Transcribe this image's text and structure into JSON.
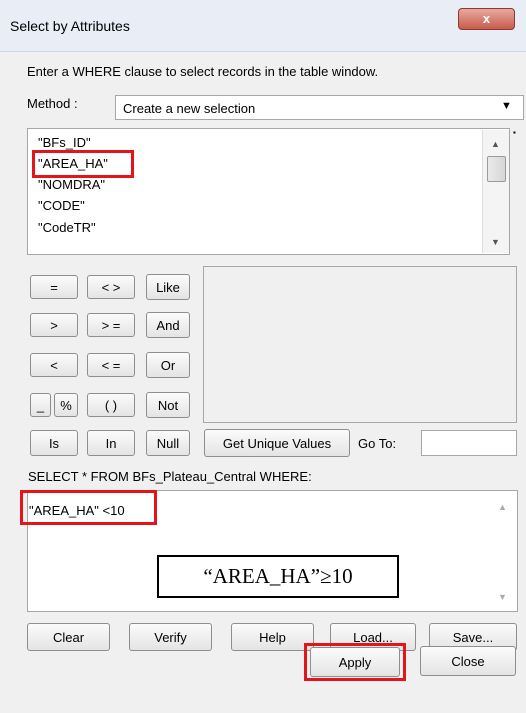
{
  "window": {
    "title": "Select by Attributes",
    "close_label": "x"
  },
  "instruction": "Enter a WHERE clause to select records in the table window.",
  "method": {
    "label": "Method :",
    "value": "Create a new selection"
  },
  "fields": [
    "\"BFs_ID\"",
    "\"AREA_HA\"",
    "\"NOMDRA\"",
    "\"CODE\"",
    "\"CodeTR\""
  ],
  "operators": {
    "eq": "=",
    "ne": "< >",
    "like": "Like",
    "gt": ">",
    "ge": "> =",
    "and": "And",
    "lt": "<",
    "le": "< =",
    "or": "Or",
    "underscore": "_",
    "percent": "%",
    "parens": "( )",
    "not": "Not",
    "is": "Is",
    "in": "In",
    "null": "Null"
  },
  "get_unique_values": "Get Unique Values",
  "goto_label": "Go To:",
  "sql_prefix": "SELECT * FROM BFs_Plateau_Central WHERE:",
  "expression": "\"AREA_HA\" <10",
  "annotation": "“AREA_HA”≥10",
  "buttons": {
    "clear": "Clear",
    "verify": "Verify",
    "help": "Help",
    "load": "Load...",
    "save": "Save...",
    "apply": "Apply",
    "close": "Close"
  },
  "colors": {
    "highlight": "#e3141a"
  }
}
